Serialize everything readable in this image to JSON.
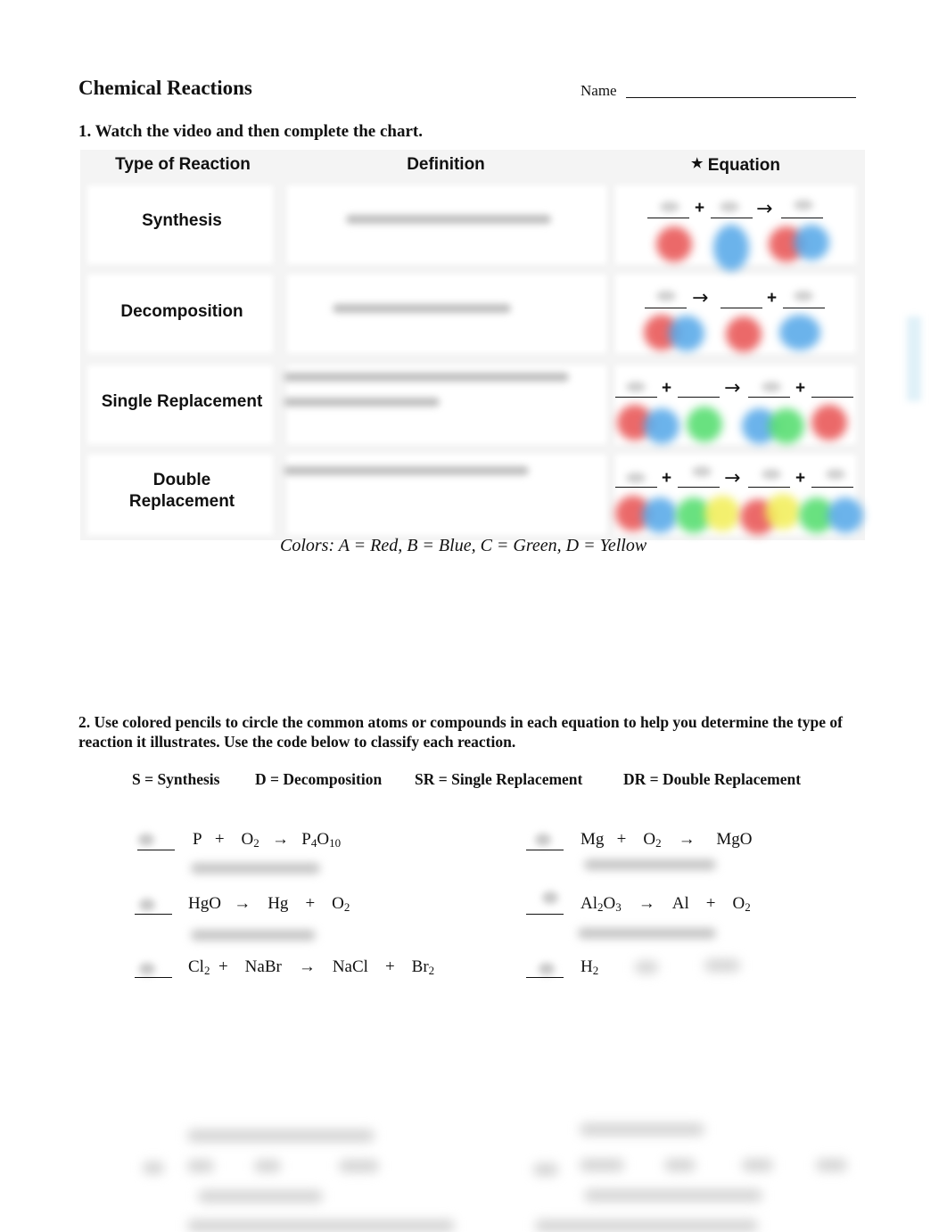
{
  "header": {
    "title": "Chemical Reactions",
    "name_label": "Name"
  },
  "section1": {
    "instruction": "1. Watch the video and then complete the chart.",
    "columns": {
      "type": "Type of Reaction",
      "definition": "Definition",
      "equation_icon": "star-icon",
      "equation_star": "★",
      "equation": "Equation"
    },
    "rows": [
      {
        "type": "Synthesis",
        "definition": "",
        "equation_symbols": [
          "+",
          "→"
        ],
        "atoms": [
          [
            "red"
          ],
          [
            "blue"
          ],
          [
            "red",
            "blue"
          ]
        ]
      },
      {
        "type": "Decomposition",
        "definition": "",
        "equation_symbols": [
          "→",
          "+"
        ],
        "atoms": [
          [
            "red",
            "blue"
          ],
          [
            "red"
          ],
          [
            "blue"
          ]
        ]
      },
      {
        "type": "Single Replacement",
        "definition": "",
        "equation_symbols": [
          "+",
          "→",
          "+"
        ],
        "atoms": [
          [
            "red",
            "blue"
          ],
          [
            "green"
          ],
          [
            "blue",
            "green"
          ],
          [
            "red"
          ]
        ]
      },
      {
        "type_line1": "Double",
        "type_line2": "Replacement",
        "definition": "",
        "equation_symbols": [
          "+",
          "→",
          "+"
        ],
        "atoms": [
          [
            "red",
            "blue"
          ],
          [
            "green",
            "yellow"
          ],
          [
            "red",
            "yellow"
          ],
          [
            "green",
            "blue"
          ]
        ]
      }
    ],
    "color_legend": "Colors:  A = Red, B = Blue, C = Green, D = Yellow",
    "colors": {
      "red": "#e85050",
      "blue": "#52a6e8",
      "green": "#4fdc6a",
      "yellow": "#f2ee55"
    }
  },
  "section2": {
    "instruction": "2. Use colored pencils to circle the common atoms or compounds in each equation to help you determine the type of reaction it illustrates. Use the code below to classify each reaction.",
    "codes": [
      "S = Synthesis",
      "D = Decomposition",
      "SR = Single Replacement",
      "DR = Double Replacement"
    ],
    "problems_left": [
      {
        "answer": "",
        "reactants": [
          "P",
          "O2"
        ],
        "products": [
          "P4O10"
        ]
      },
      {
        "answer": "",
        "reactants": [
          "HgO"
        ],
        "products": [
          "Hg",
          "O2"
        ]
      },
      {
        "answer": "",
        "reactants": [
          "Cl2",
          "NaBr"
        ],
        "products": [
          "NaCl",
          "Br2"
        ]
      }
    ],
    "problems_right": [
      {
        "answer": "",
        "reactants": [
          "Mg",
          "O2"
        ],
        "products": [
          "MgO"
        ]
      },
      {
        "answer": "",
        "reactants": [
          "Al2O3"
        ],
        "products": [
          "Al",
          "O2"
        ]
      },
      {
        "answer": "",
        "reactants": [
          "H2"
        ],
        "products": []
      }
    ],
    "text": {
      "P": "P",
      "plus": "+",
      "arrow": "→",
      "O": "O",
      "sub2": "2",
      "sub3": "3",
      "sub4": "4",
      "sub10": "10",
      "HgO": "HgO",
      "Hg": "Hg",
      "Cl": "Cl",
      "NaBr": "NaBr",
      "NaCl": "NaCl",
      "Br": "Br",
      "Mg": "Mg",
      "MgO": "MgO",
      "Al": "Al",
      "H": "H"
    }
  }
}
